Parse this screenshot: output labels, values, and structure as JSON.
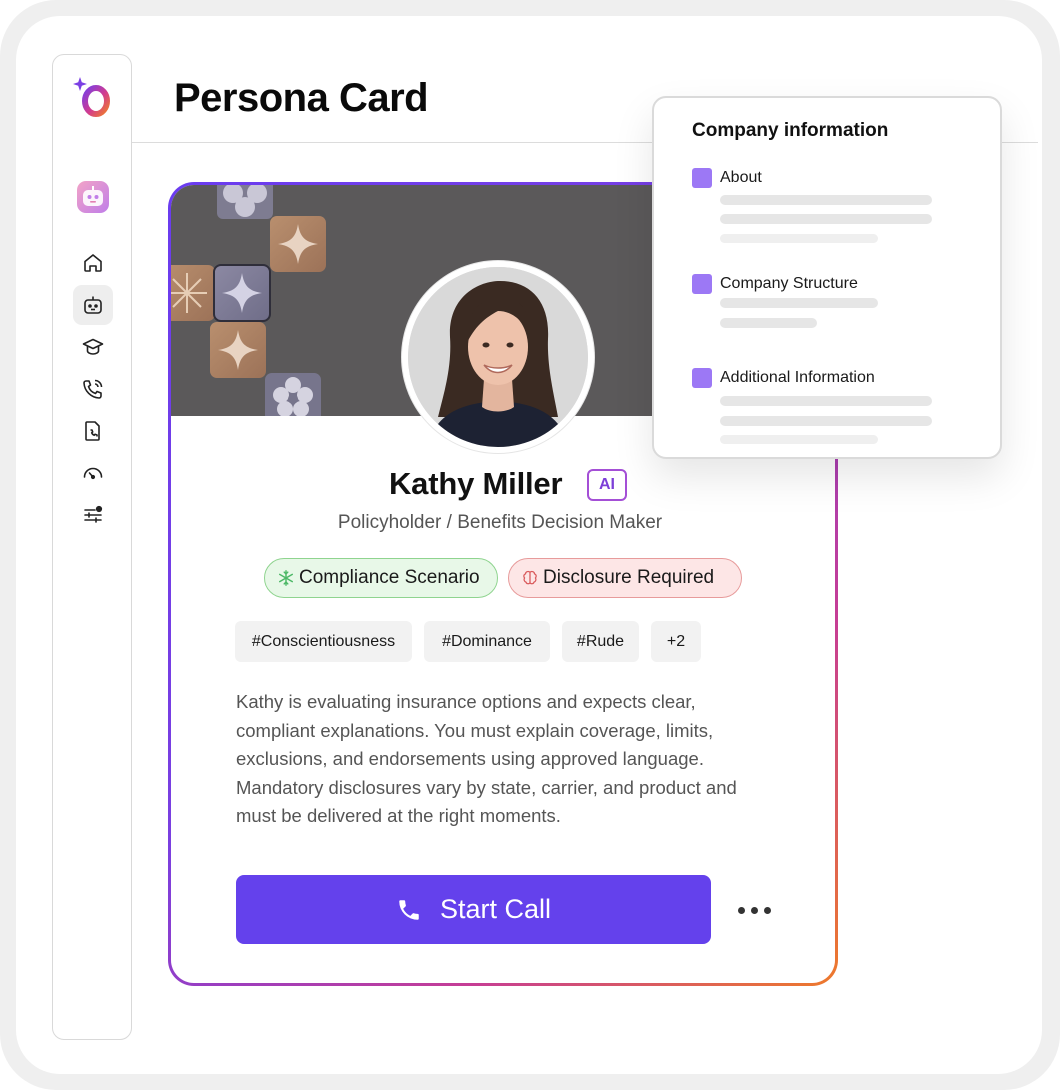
{
  "page": {
    "title": "Persona Card"
  },
  "sidebar": {
    "logo_icon": "brand-logo-icon",
    "avatar_icon": "bot-avatar-icon",
    "items": [
      {
        "icon": "home-icon",
        "active": false
      },
      {
        "icon": "bot-icon",
        "active": true
      },
      {
        "icon": "graduation-cap-icon",
        "active": false
      },
      {
        "icon": "phone-call-icon",
        "active": false
      },
      {
        "icon": "phone-document-icon",
        "active": false
      },
      {
        "icon": "gauge-icon",
        "active": false
      },
      {
        "icon": "sliders-icon",
        "active": false
      }
    ]
  },
  "persona": {
    "name": "Kathy Miller",
    "ai_badge": "AI",
    "role": "Policyholder / Benefits Decision Maker",
    "scenario_pills": [
      {
        "label": "Compliance Scenario",
        "icon": "snowflake-icon",
        "color": "#8fd48f"
      },
      {
        "label": "Disclosure Required",
        "icon": "brain-icon",
        "color": "#e79b9b"
      }
    ],
    "tags": [
      "#Conscientiousness",
      "#Dominance",
      "#Rude",
      "+2"
    ],
    "description": "Kathy is evaluating insurance options and expects clear, compliant explanations. You must explain coverage, limits, exclusions, and endorsements using approved language. Mandatory disclosures vary by state, carrier, and product and must be delivered at the right moments.",
    "start_call_label": "Start Call",
    "more_icon": "more-horizontal-icon"
  },
  "company_panel": {
    "title": "Company information",
    "sections": [
      {
        "label": "About"
      },
      {
        "label": "Company Structure"
      },
      {
        "label": "Additional Information"
      }
    ]
  },
  "colors": {
    "accent": "#6441ec",
    "section_marker": "#9c78f5",
    "card_gradient_start": "#6a3cf0",
    "card_gradient_end": "#ee7a2a"
  }
}
